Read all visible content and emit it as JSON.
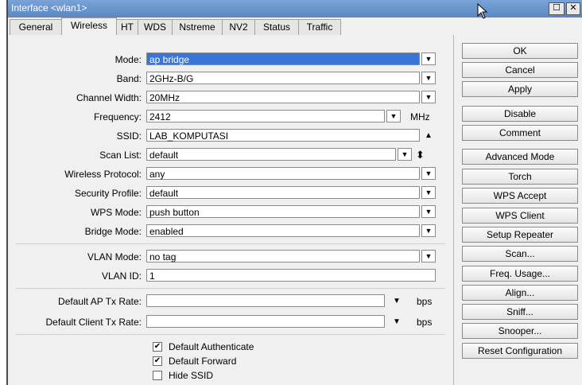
{
  "window": {
    "title": "Interface <wlan1>",
    "restore_glyph": "☐",
    "close_glyph": "✕"
  },
  "tabs": [
    "General",
    "Wireless",
    "HT",
    "WDS",
    "Nstreme",
    "NV2",
    "Status",
    "Traffic"
  ],
  "active_tab": "Wireless",
  "fields": {
    "mode": {
      "label": "Mode:",
      "value": "ap bridge"
    },
    "band": {
      "label": "Band:",
      "value": "2GHz-B/G"
    },
    "channel_width": {
      "label": "Channel Width:",
      "value": "20MHz"
    },
    "frequency": {
      "label": "Frequency:",
      "value": "2412",
      "unit": "MHz"
    },
    "ssid": {
      "label": "SSID:",
      "value": "LAB_KOMPUTASI"
    },
    "scan_list": {
      "label": "Scan List:",
      "value": "default"
    },
    "wireless_protocol": {
      "label": "Wireless Protocol:",
      "value": "any"
    },
    "security_profile": {
      "label": "Security Profile:",
      "value": "default"
    },
    "wps_mode": {
      "label": "WPS Mode:",
      "value": "push button"
    },
    "bridge_mode": {
      "label": "Bridge Mode:",
      "value": "enabled"
    },
    "vlan_mode": {
      "label": "VLAN Mode:",
      "value": "no tag"
    },
    "vlan_id": {
      "label": "VLAN ID:",
      "value": "1"
    },
    "default_ap_tx_rate": {
      "label": "Default AP Tx Rate:",
      "value": "",
      "unit": "bps"
    },
    "default_client_tx_rate": {
      "label": "Default Client Tx Rate:",
      "value": "",
      "unit": "bps"
    }
  },
  "checkboxes": [
    {
      "label": "Default Authenticate",
      "checked": true
    },
    {
      "label": "Default Forward",
      "checked": true
    },
    {
      "label": "Hide SSID",
      "checked": false
    }
  ],
  "buttons": [
    "OK",
    "Cancel",
    "Apply",
    "Disable",
    "Comment",
    "Advanced Mode",
    "Torch",
    "WPS Accept",
    "WPS Client",
    "Setup Repeater",
    "Scan...",
    "Freq. Usage...",
    "Align...",
    "Sniff...",
    "Snooper...",
    "Reset Configuration"
  ],
  "glyphs": {
    "dropdown": "▼",
    "up": "▲",
    "updown": "⬍",
    "check": "✔"
  }
}
